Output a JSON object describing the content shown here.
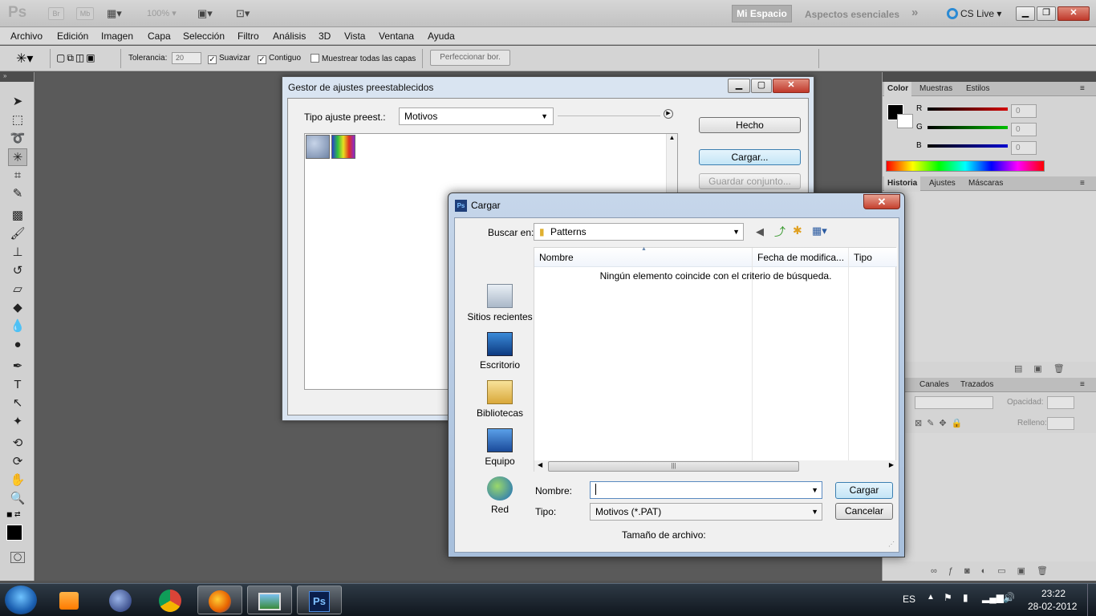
{
  "appbar": {
    "logo": "Ps",
    "br": "Br",
    "mb": "Mb",
    "zoom": "100%",
    "workspace_active": "Mi Espacio",
    "workspace_other": "Aspectos esenciales",
    "more": "»",
    "cslive": "CS Live"
  },
  "menu": [
    "Archivo",
    "Edición",
    "Imagen",
    "Capa",
    "Selección",
    "Filtro",
    "Análisis",
    "3D",
    "Vista",
    "Ventana",
    "Ayuda"
  ],
  "options": {
    "tolerance_label": "Tolerancia:",
    "tolerance_value": "20",
    "smooth_label": "Suavizar",
    "contiguous_label": "Contiguo",
    "sample_all_label": "Muestrear todas las capas",
    "refine_label": "Perfeccionar bor."
  },
  "color_panel": {
    "tabs": [
      "Color",
      "Muestras",
      "Estilos"
    ],
    "channels": [
      {
        "label": "R",
        "value": "0",
        "color": "#d40000"
      },
      {
        "label": "G",
        "value": "0",
        "color": "#00c000"
      },
      {
        "label": "B",
        "value": "0",
        "color": "#0000d0"
      }
    ]
  },
  "history_panel": {
    "tabs": [
      "Historia",
      "Ajustes",
      "Máscaras"
    ]
  },
  "layers_panel": {
    "tabs": [
      "Canales",
      "Trazados"
    ],
    "opacity_label": "Opacidad:",
    "fill_label": "Relleno:"
  },
  "preset_manager": {
    "title": "Gestor de ajustes preestablecidos",
    "type_label": "Tipo ajuste preest.:",
    "type_value": "Motivos",
    "done": "Hecho",
    "load": "Cargar...",
    "save_set": "Guardar conjunto..."
  },
  "load_dialog": {
    "title": "Cargar",
    "close": "✕",
    "look_in_label": "Buscar en:",
    "look_in_value": "Patterns",
    "places": [
      "Sitios recientes",
      "Escritorio",
      "Bibliotecas",
      "Equipo",
      "Red"
    ],
    "columns": [
      "Nombre",
      "Fecha de modifica...",
      "Tipo"
    ],
    "empty_message": "Ningún elemento coincide con el criterio de búsqueda.",
    "name_label": "Nombre:",
    "name_value": "",
    "type_label": "Tipo:",
    "type_value": "Motivos (*.PAT)",
    "size_label": "Tamaño de archivo:",
    "load_button": "Cargar",
    "cancel_button": "Cancelar"
  },
  "taskbar": {
    "lang": "ES",
    "time": "23:22",
    "date": "28-02-2012"
  }
}
